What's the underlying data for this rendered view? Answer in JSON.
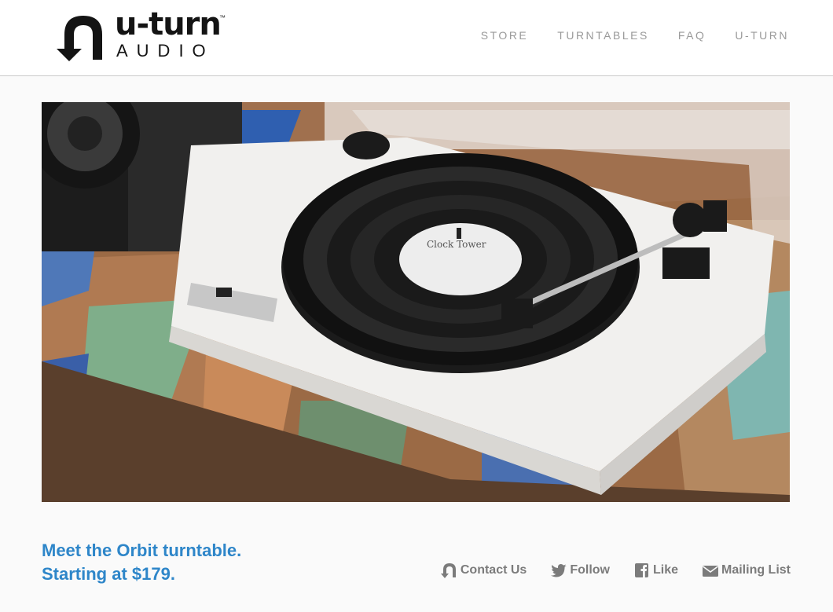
{
  "brand": {
    "name_line1": "u-turn",
    "name_line2": "AUDIO",
    "trademark": "™"
  },
  "nav": {
    "items": [
      {
        "label": "STORE"
      },
      {
        "label": "TURNTABLES"
      },
      {
        "label": "FAQ"
      },
      {
        "label": "U-TURN"
      }
    ]
  },
  "hero": {
    "record_label_text": "Clock Tower"
  },
  "promo": {
    "line1": "Meet the Orbit turntable.",
    "line2": "Starting at $179."
  },
  "footer_links": {
    "contact": "Contact Us",
    "follow": "Follow",
    "like": "Like",
    "mailing": "Mailing List"
  },
  "colors": {
    "accent": "#2e86c9",
    "nav_text": "#9a9a9a",
    "footer_text": "#7b7b7b"
  }
}
